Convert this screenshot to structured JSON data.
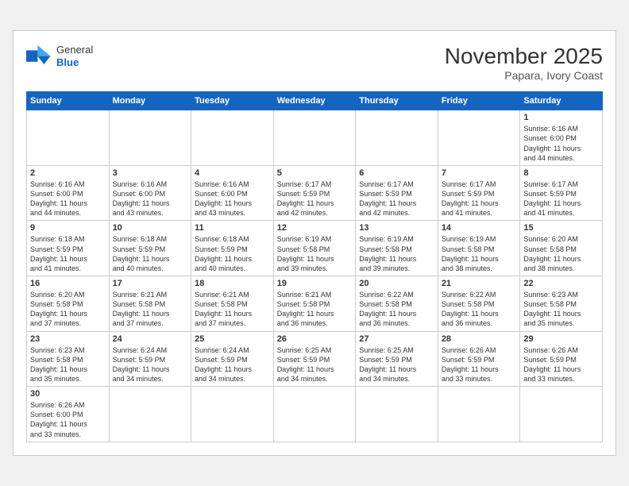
{
  "header": {
    "logo_general": "General",
    "logo_blue": "Blue",
    "month_title": "November 2025",
    "location": "Papara, Ivory Coast"
  },
  "weekdays": [
    "Sunday",
    "Monday",
    "Tuesday",
    "Wednesday",
    "Thursday",
    "Friday",
    "Saturday"
  ],
  "weeks": [
    [
      {
        "day": "",
        "info": ""
      },
      {
        "day": "",
        "info": ""
      },
      {
        "day": "",
        "info": ""
      },
      {
        "day": "",
        "info": ""
      },
      {
        "day": "",
        "info": ""
      },
      {
        "day": "",
        "info": ""
      },
      {
        "day": "1",
        "info": "Sunrise: 6:16 AM\nSunset: 6:00 PM\nDaylight: 11 hours\nand 44 minutes."
      }
    ],
    [
      {
        "day": "2",
        "info": "Sunrise: 6:16 AM\nSunset: 6:00 PM\nDaylight: 11 hours\nand 44 minutes."
      },
      {
        "day": "3",
        "info": "Sunrise: 6:16 AM\nSunset: 6:00 PM\nDaylight: 11 hours\nand 43 minutes."
      },
      {
        "day": "4",
        "info": "Sunrise: 6:16 AM\nSunset: 6:00 PM\nDaylight: 11 hours\nand 43 minutes."
      },
      {
        "day": "5",
        "info": "Sunrise: 6:17 AM\nSunset: 5:59 PM\nDaylight: 11 hours\nand 42 minutes."
      },
      {
        "day": "6",
        "info": "Sunrise: 6:17 AM\nSunset: 5:59 PM\nDaylight: 11 hours\nand 42 minutes."
      },
      {
        "day": "7",
        "info": "Sunrise: 6:17 AM\nSunset: 5:59 PM\nDaylight: 11 hours\nand 41 minutes."
      },
      {
        "day": "8",
        "info": "Sunrise: 6:17 AM\nSunset: 5:59 PM\nDaylight: 11 hours\nand 41 minutes."
      }
    ],
    [
      {
        "day": "9",
        "info": "Sunrise: 6:18 AM\nSunset: 5:59 PM\nDaylight: 11 hours\nand 41 minutes."
      },
      {
        "day": "10",
        "info": "Sunrise: 6:18 AM\nSunset: 5:59 PM\nDaylight: 11 hours\nand 40 minutes."
      },
      {
        "day": "11",
        "info": "Sunrise: 6:18 AM\nSunset: 5:59 PM\nDaylight: 11 hours\nand 40 minutes."
      },
      {
        "day": "12",
        "info": "Sunrise: 6:19 AM\nSunset: 5:58 PM\nDaylight: 11 hours\nand 39 minutes."
      },
      {
        "day": "13",
        "info": "Sunrise: 6:19 AM\nSunset: 5:58 PM\nDaylight: 11 hours\nand 39 minutes."
      },
      {
        "day": "14",
        "info": "Sunrise: 6:19 AM\nSunset: 5:58 PM\nDaylight: 11 hours\nand 38 minutes."
      },
      {
        "day": "15",
        "info": "Sunrise: 6:20 AM\nSunset: 5:58 PM\nDaylight: 11 hours\nand 38 minutes."
      }
    ],
    [
      {
        "day": "16",
        "info": "Sunrise: 6:20 AM\nSunset: 5:58 PM\nDaylight: 11 hours\nand 37 minutes."
      },
      {
        "day": "17",
        "info": "Sunrise: 6:21 AM\nSunset: 5:58 PM\nDaylight: 11 hours\nand 37 minutes."
      },
      {
        "day": "18",
        "info": "Sunrise: 6:21 AM\nSunset: 5:58 PM\nDaylight: 11 hours\nand 37 minutes."
      },
      {
        "day": "19",
        "info": "Sunrise: 6:21 AM\nSunset: 5:58 PM\nDaylight: 11 hours\nand 36 minutes."
      },
      {
        "day": "20",
        "info": "Sunrise: 6:22 AM\nSunset: 5:58 PM\nDaylight: 11 hours\nand 36 minutes."
      },
      {
        "day": "21",
        "info": "Sunrise: 6:22 AM\nSunset: 5:58 PM\nDaylight: 11 hours\nand 36 minutes."
      },
      {
        "day": "22",
        "info": "Sunrise: 6:23 AM\nSunset: 5:58 PM\nDaylight: 11 hours\nand 35 minutes."
      }
    ],
    [
      {
        "day": "23",
        "info": "Sunrise: 6:23 AM\nSunset: 5:58 PM\nDaylight: 11 hours\nand 35 minutes."
      },
      {
        "day": "24",
        "info": "Sunrise: 6:24 AM\nSunset: 5:59 PM\nDaylight: 11 hours\nand 34 minutes."
      },
      {
        "day": "25",
        "info": "Sunrise: 6:24 AM\nSunset: 5:59 PM\nDaylight: 11 hours\nand 34 minutes."
      },
      {
        "day": "26",
        "info": "Sunrise: 6:25 AM\nSunset: 5:59 PM\nDaylight: 11 hours\nand 34 minutes."
      },
      {
        "day": "27",
        "info": "Sunrise: 6:25 AM\nSunset: 5:59 PM\nDaylight: 11 hours\nand 34 minutes."
      },
      {
        "day": "28",
        "info": "Sunrise: 6:26 AM\nSunset: 5:59 PM\nDaylight: 11 hours\nand 33 minutes."
      },
      {
        "day": "29",
        "info": "Sunrise: 6:26 AM\nSunset: 5:59 PM\nDaylight: 11 hours\nand 33 minutes."
      }
    ],
    [
      {
        "day": "30",
        "info": "Sunrise: 6:26 AM\nSunset: 6:00 PM\nDaylight: 11 hours\nand 33 minutes."
      },
      {
        "day": "",
        "info": ""
      },
      {
        "day": "",
        "info": ""
      },
      {
        "day": "",
        "info": ""
      },
      {
        "day": "",
        "info": ""
      },
      {
        "day": "",
        "info": ""
      },
      {
        "day": "",
        "info": ""
      }
    ]
  ]
}
